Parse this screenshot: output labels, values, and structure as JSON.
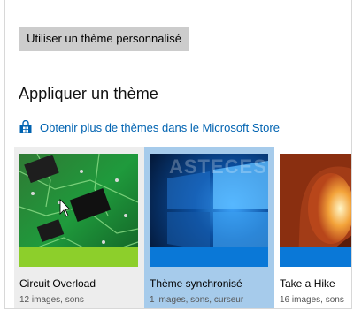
{
  "custom_theme_button": "Utiliser un thème personnalisé",
  "section_title": "Appliquer un thème",
  "store_link": {
    "label": "Obtenir plus de thèmes dans le Microsoft Store",
    "icon": "store-bag-icon"
  },
  "watermark": "ASTECES",
  "themes": [
    {
      "name": "Circuit Overload",
      "description": "12 images, sons",
      "accent": "#8dcf2b",
      "selected": false
    },
    {
      "name": "Thème synchronisé",
      "description": "1 images, sons, curseur",
      "accent": "#0a78d7",
      "selected": true
    },
    {
      "name": "Take a Hike",
      "description": "16 images, sons",
      "accent": "#0a78d7",
      "selected": false
    }
  ],
  "colors": {
    "link": "#0063b1",
    "button_bg": "#cccccc",
    "selected_tile": "#a6cbeb",
    "hover_tile": "#ededed"
  }
}
